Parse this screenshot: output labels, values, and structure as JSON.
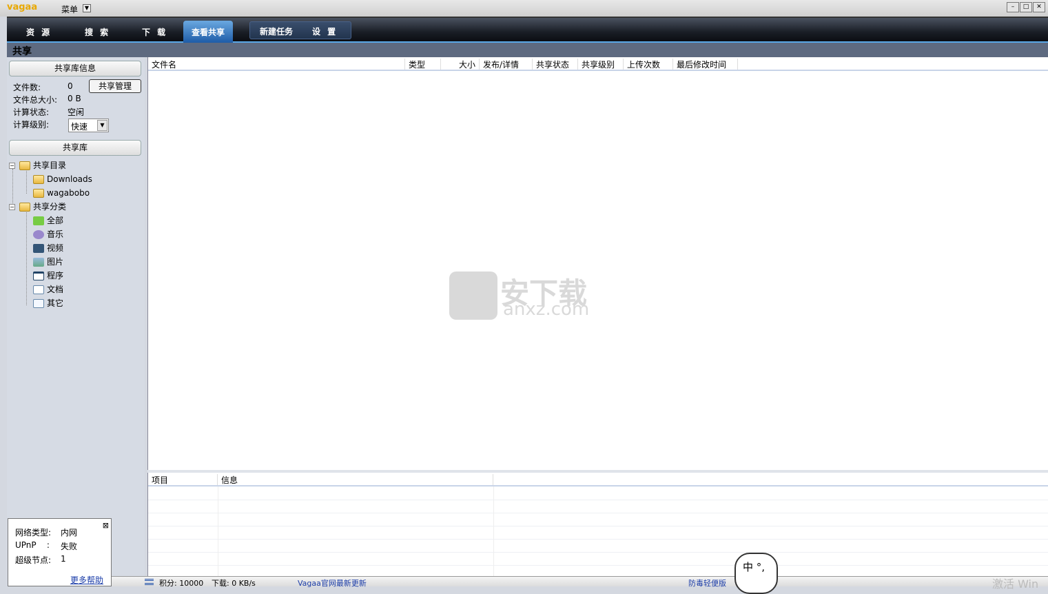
{
  "app": {
    "logo": "vagaa",
    "menu_label": "菜单"
  },
  "nav": {
    "tabs": [
      "资 源",
      "搜 索",
      "下 载",
      "查看共享"
    ],
    "group": [
      "新建任务",
      "设 置"
    ],
    "active": "查看共享"
  },
  "section_title": "共享",
  "library_info": {
    "header": "共享库信息",
    "file_count_label": "文件数:",
    "file_count": "0",
    "total_size_label": "文件总大小:",
    "total_size": "0 B",
    "calc_status_label": "计算状态:",
    "calc_status": "空闲",
    "calc_level_label": "计算级别:",
    "calc_level": "快速",
    "manage_button": "共享管理"
  },
  "library": {
    "header": "共享库",
    "tree": [
      {
        "label": "共享目录",
        "children": [
          "Downloads",
          "wagabobo"
        ]
      },
      {
        "label": "共享分类",
        "children": [
          "全部",
          "音乐",
          "视频",
          "图片",
          "程序",
          "文档",
          "其它"
        ]
      }
    ]
  },
  "file_table": {
    "columns": [
      "文件名",
      "类型",
      "大小",
      "发布/详情",
      "共享状态",
      "共享级别",
      "上传次数",
      "最后修改时间"
    ],
    "rows": []
  },
  "detail_table": {
    "columns": [
      "项目",
      "信息"
    ],
    "rows": []
  },
  "network": {
    "type_label": "网络类型:",
    "type": "内网",
    "upnp_label": "UPnP    :",
    "upnp": "失败",
    "supernode_label": "超级节点:",
    "supernode": "1",
    "help_link": "更多帮助"
  },
  "statusbar": {
    "points": "积分: 10000",
    "download": "下载: 0 KB/s",
    "news": "Vagaa官网最新更新",
    "antivirus": "防毒轻便版",
    "activate": "激活 Win"
  },
  "watermark": {
    "text": "安下载",
    "domain": "anxz.com"
  },
  "ime": {
    "text": "中 °,"
  }
}
